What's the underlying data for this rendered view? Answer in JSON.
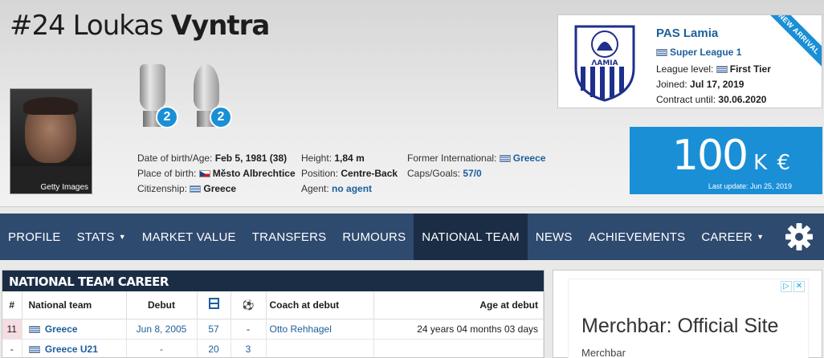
{
  "player": {
    "number": "#24",
    "first_name": "Loukas",
    "last_name": "Vyntra",
    "photo_caption": "Getty Images"
  },
  "trophies": [
    {
      "name": "trophy-1",
      "count": "2"
    },
    {
      "name": "trophy-2",
      "count": "2"
    }
  ],
  "info_col1": {
    "dob_label": "Date of birth/Age:",
    "dob_value": "Feb 5, 1981 (38)",
    "pob_label": "Place of birth:",
    "pob_value": "Město Albrechtice",
    "cit_label": "Citizenship:",
    "cit_value": "Greece"
  },
  "info_col2": {
    "height_label": "Height:",
    "height_value": "1,84 m",
    "pos_label": "Position:",
    "pos_value": "Centre-Back",
    "agent_label": "Agent:",
    "agent_value": "no agent"
  },
  "info_col3": {
    "intl_label": "Former International:",
    "intl_value": "Greece",
    "caps_label": "Caps/Goals:",
    "caps_value": "57/0"
  },
  "club": {
    "name": "PAS Lamia",
    "league": "Super League 1",
    "level_label": "League level:",
    "level_value": "First Tier",
    "joined_label": "Joined:",
    "joined_value": "Jul 17, 2019",
    "contract_label": "Contract until:",
    "contract_value": "30.06.2020",
    "ribbon": "NEW ARRIVAL",
    "crest_text": "ΛΑΜΙΑ"
  },
  "market_value": {
    "amount": "100",
    "unit": "K €",
    "updated": "Last update: Jun 25, 2019"
  },
  "nav": {
    "items": [
      "PROFILE",
      "STATS",
      "MARKET VALUE",
      "TRANSFERS",
      "RUMOURS",
      "NATIONAL TEAM",
      "NEWS",
      "ACHIEVEMENTS",
      "CAREER"
    ],
    "active": "NATIONAL TEAM"
  },
  "national_team": {
    "title": "NATIONAL TEAM CAREER",
    "headers": {
      "idx": "#",
      "team": "National team",
      "debut": "Debut",
      "coach": "Coach at debut",
      "age": "Age at debut"
    },
    "rows": [
      {
        "idx": "11",
        "team": "Greece",
        "debut": "Jun 8, 2005",
        "caps": "57",
        "goals": "-",
        "coach": "Otto Rehhagel",
        "age": "24 years 04 months 03 days"
      },
      {
        "idx": "-",
        "team": "Greece U21",
        "debut": "-",
        "caps": "20",
        "goals": "3",
        "coach": "",
        "age": ""
      }
    ]
  },
  "ad": {
    "title": "Merchbar: Official Site",
    "sub": "Merchbar"
  }
}
